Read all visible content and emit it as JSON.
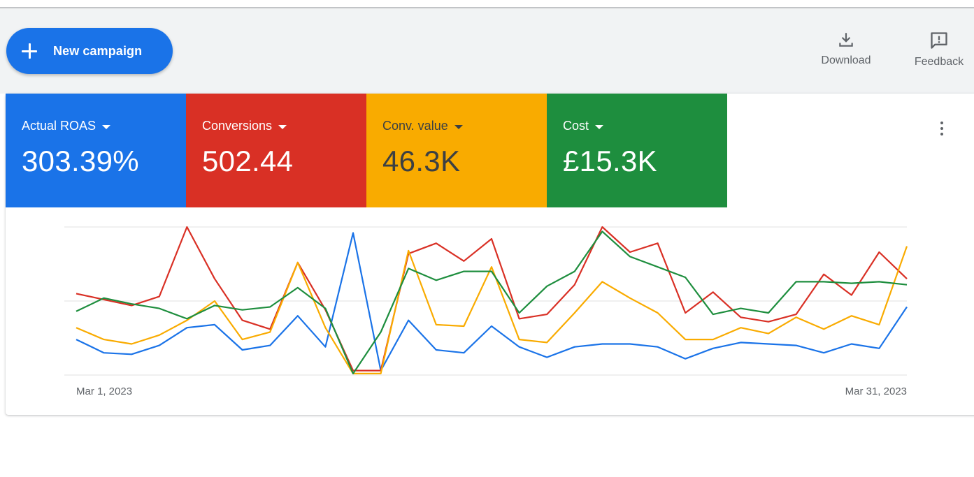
{
  "toolbar": {
    "new_campaign_label": "New campaign",
    "download_label": "Download",
    "feedback_label": "Feedback"
  },
  "metrics": [
    {
      "label": "Actual ROAS",
      "value": "303.39%",
      "color": "#1a73e8"
    },
    {
      "label": "Conversions",
      "value": "502.44",
      "color": "#d93025"
    },
    {
      "label": "Conv. value",
      "value": "46.3K",
      "color": "#f9ab00"
    },
    {
      "label": "Cost",
      "value": "£15.3K",
      "color": "#1e8e3e"
    }
  ],
  "chart_data": {
    "type": "line",
    "x_start_label": "Mar 1, 2023",
    "x_end_label": "Mar 31, 2023",
    "x": [
      "Mar 1",
      "Mar 2",
      "Mar 3",
      "Mar 4",
      "Mar 5",
      "Mar 6",
      "Mar 7",
      "Mar 8",
      "Mar 9",
      "Mar 10",
      "Mar 11",
      "Mar 12",
      "Mar 13",
      "Mar 14",
      "Mar 15",
      "Mar 16",
      "Mar 17",
      "Mar 18",
      "Mar 19",
      "Mar 20",
      "Mar 21",
      "Mar 22",
      "Mar 23",
      "Mar 24",
      "Mar 25",
      "Mar 26",
      "Mar 27",
      "Mar 28",
      "Mar 29",
      "Mar 30",
      "Mar 31"
    ],
    "grid": true,
    "relative_scale": [
      0,
      1
    ],
    "series": [
      {
        "metric": "Actual ROAS",
        "color": "#1a73e8",
        "values": [
          0.24,
          0.15,
          0.14,
          0.2,
          0.32,
          0.34,
          0.17,
          0.2,
          0.4,
          0.19,
          0.96,
          0.03,
          0.37,
          0.17,
          0.15,
          0.33,
          0.19,
          0.12,
          0.19,
          0.21,
          0.21,
          0.19,
          0.11,
          0.18,
          0.22,
          0.21,
          0.2,
          0.15,
          0.21,
          0.18,
          0.46
        ]
      },
      {
        "metric": "Conversions",
        "color": "#d93025",
        "values": [
          0.55,
          0.51,
          0.47,
          0.53,
          1.0,
          0.65,
          0.37,
          0.31,
          0.76,
          0.44,
          0.03,
          0.03,
          0.82,
          0.89,
          0.77,
          0.92,
          0.38,
          0.41,
          0.61,
          1.0,
          0.83,
          0.89,
          0.42,
          0.56,
          0.39,
          0.36,
          0.41,
          0.68,
          0.54,
          0.83,
          0.65
        ]
      },
      {
        "metric": "Conv. value",
        "color": "#f9ab00",
        "values": [
          0.32,
          0.24,
          0.21,
          0.27,
          0.37,
          0.5,
          0.24,
          0.29,
          0.76,
          0.32,
          0.01,
          0.01,
          0.84,
          0.34,
          0.33,
          0.73,
          0.24,
          0.22,
          0.42,
          0.63,
          0.52,
          0.42,
          0.24,
          0.24,
          0.32,
          0.28,
          0.39,
          0.31,
          0.4,
          0.34,
          0.87
        ]
      },
      {
        "metric": "Cost",
        "color": "#1e8e3e",
        "values": [
          0.43,
          0.52,
          0.48,
          0.45,
          0.38,
          0.47,
          0.44,
          0.46,
          0.59,
          0.45,
          0.01,
          0.29,
          0.72,
          0.64,
          0.7,
          0.7,
          0.42,
          0.6,
          0.7,
          0.97,
          0.8,
          0.73,
          0.66,
          0.41,
          0.45,
          0.42,
          0.63,
          0.63,
          0.62,
          0.63,
          0.61
        ]
      }
    ]
  }
}
